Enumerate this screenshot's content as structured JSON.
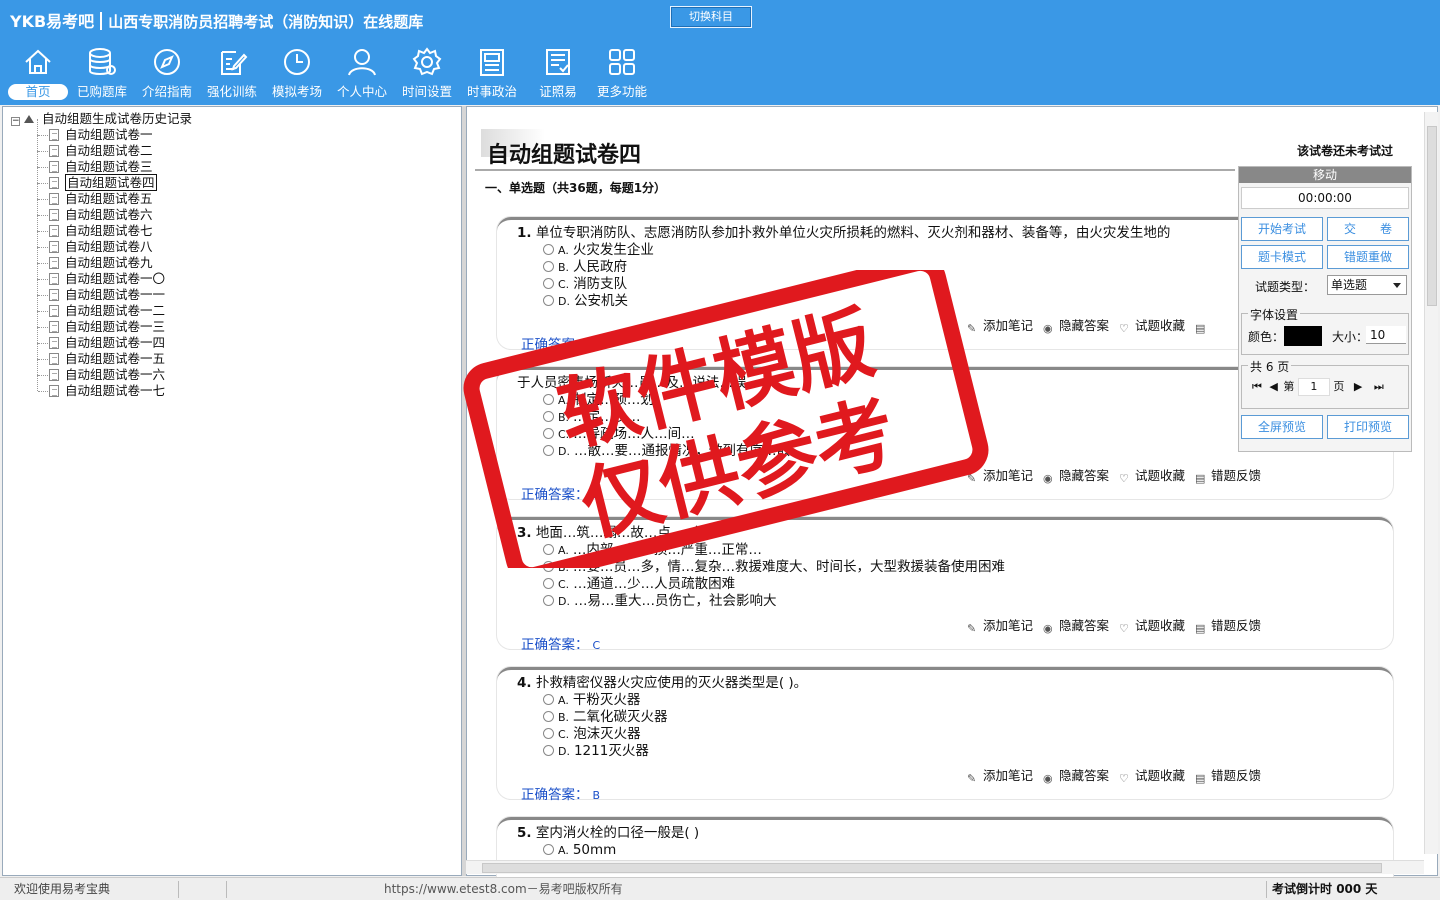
{
  "app": {
    "logo": "YKB易考吧",
    "title": "山西专职消防员招聘考试（消防知识）在线题库",
    "switch_label": "切换科目"
  },
  "nav": [
    {
      "label": "首页",
      "icon": "home-icon"
    },
    {
      "label": "已购题库",
      "icon": "database-icon"
    },
    {
      "label": "介绍指南",
      "icon": "compass-icon"
    },
    {
      "label": "强化训练",
      "icon": "edit-icon"
    },
    {
      "label": "模拟考场",
      "icon": "clock-icon"
    },
    {
      "label": "个人中心",
      "icon": "user-icon"
    },
    {
      "label": "时间设置",
      "icon": "gear-icon"
    },
    {
      "label": "时事政治",
      "icon": "news-icon"
    },
    {
      "label": "证照易",
      "icon": "certificate-icon"
    },
    {
      "label": "更多功能",
      "icon": "grid-icon"
    }
  ],
  "tree": {
    "root": "自动组题生成试卷历史记录",
    "items": [
      "自动组题试卷一",
      "自动组题试卷二",
      "自动组题试卷三",
      "自动组题试卷四",
      "自动组题试卷五",
      "自动组题试卷六",
      "自动组题试卷七",
      "自动组题试卷八",
      "自动组题试卷九",
      "自动组题试卷一〇",
      "自动组题试卷一一",
      "自动组题试卷一二",
      "自动组题试卷一三",
      "自动组题试卷一四",
      "自动组题试卷一五",
      "自动组题试卷一六",
      "自动组题试卷一七"
    ],
    "selected_index": 3
  },
  "paper": {
    "title": "自动组题试卷四",
    "status": "该试卷还未考试过",
    "section": "一、单选题（共36题，每题1分）"
  },
  "action_labels": {
    "note": "添加笔记",
    "hide": "隐藏答案",
    "fav": "试题收藏",
    "report": "错题反馈"
  },
  "answer_label": "正确答案：",
  "questions": [
    {
      "num": "1.",
      "text": "单位专职消防队、志愿消防队参加扑救外单位火灾所损耗的燃料、灭火剂和器材、装备等，由火灾发生地的",
      "options": [
        [
          "A.",
          "火灾发生企业"
        ],
        [
          "B.",
          "人民政府"
        ],
        [
          "C.",
          "消防支队"
        ],
        [
          "D.",
          "公安机关"
        ]
      ],
      "answer": "B",
      "actions": [
        "添加笔记",
        "隐藏答案",
        "试题收藏"
      ]
    },
    {
      "num": "",
      "text": "于人员密集场所火…员…及…说法…误。",
      "options": [
        [
          "A.",
          "制定…预…划"
        ],
        [
          "B.",
          "…定…及…"
        ],
        [
          "C.",
          "…导疏场…人…间…"
        ],
        [
          "D.",
          "…散…要…通报情况，做到有序…散"
        ]
      ],
      "answer": "C",
      "actions": [
        "添加笔记",
        "隐藏答案",
        "试题收藏",
        "错题反馈"
      ]
    },
    {
      "num": "3.",
      "text": "地面…筑…塌…故…点…（ ）",
      "options": [
        [
          "A.",
          "…内部…设…损…严重…正常…"
        ],
        [
          "B.",
          "…要…员…多，情…复杂…救援难度大、时间长，大型救援装备使用困难"
        ],
        [
          "C.",
          "…通道…少…人员疏散困难"
        ],
        [
          "D.",
          "…易…重大…员伤亡，社会影响大"
        ]
      ],
      "answer": "C",
      "actions": [
        "添加笔记",
        "隐藏答案",
        "试题收藏",
        "错题反馈"
      ]
    },
    {
      "num": "4.",
      "text": "扑救精密仪器火灾应使用的灭火器类型是( )。",
      "options": [
        [
          "A.",
          "干粉灭火器"
        ],
        [
          "B.",
          "二氧化碳灭火器"
        ],
        [
          "C.",
          "泡沫灭火器"
        ],
        [
          "D.",
          "1211灭火器"
        ]
      ],
      "answer": "B",
      "actions": [
        "添加笔记",
        "隐藏答案",
        "试题收藏",
        "错题反馈"
      ]
    },
    {
      "num": "5.",
      "text": "室内消火栓的口径一般是( )",
      "options": [
        [
          "A.",
          "50mm"
        ]
      ],
      "answer": "",
      "actions": []
    }
  ],
  "sidepanel": {
    "header": "移动",
    "timer": "00:00:00",
    "start_btn": "开始考试",
    "submit_btn": "交　　卷",
    "card_btn": "题卡模式",
    "redo_btn": "错题重做",
    "qtype_label": "试题类型：",
    "qtype_value": "单选题",
    "font_legend": "字体设置",
    "color_label": "颜色：",
    "size_label": "大小：",
    "size_value": "10",
    "font_color": "#000000",
    "pages_legend": "共 6 页",
    "page_prefix": "第",
    "page_value": "1",
    "page_suffix": "页",
    "fullscreen_btn": "全屏预览",
    "print_btn": "打印预览"
  },
  "watermark": {
    "line1": "软件模版",
    "line2": "仅供参考",
    "color": "#e0191e"
  },
  "statusbar": {
    "left": "欢迎使用易考宝典",
    "center": "https://www.etest8.com－易考吧版权所有",
    "right_label": "考试倒计时",
    "right_value": "000 天"
  },
  "colors": {
    "topbar": "#3a98e6",
    "answer": "#1a4fc8",
    "button_text": "#3a8ee0"
  }
}
